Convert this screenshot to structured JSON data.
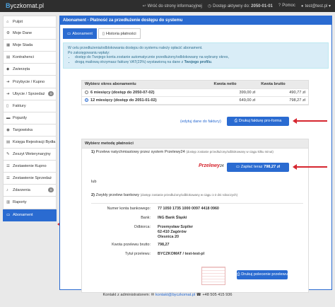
{
  "app": {
    "brand_prefix": "B",
    "brand_rest": "yczkomat.pl"
  },
  "nav": {
    "back_label": "Wróć do strony informacyjnej",
    "access_label": "Dostęp aktywny do:",
    "access_date": "2050-01-01",
    "help_label": "Pomoc",
    "user_label": "test@test.pl"
  },
  "sidebar": {
    "items": [
      {
        "label": "Pulpit",
        "icon": "home-icon"
      },
      {
        "label": "Moje Dane",
        "icon": "gear-icon"
      },
      {
        "label": "Moje Stada",
        "icon": "grid-icon"
      },
      {
        "label": "Kontrahenci",
        "icon": "book-icon"
      },
      {
        "label": "Zwierzęta",
        "icon": "tag-icon"
      },
      {
        "label": "Przybycie / Kupno",
        "icon": "arrow-icon"
      },
      {
        "label": "Ubycie / Sprzedaż",
        "icon": "arrow-icon",
        "badge": "0"
      },
      {
        "label": "Faktury",
        "icon": "doc-icon"
      },
      {
        "label": "Pojazdy",
        "icon": "truck-icon"
      },
      {
        "label": "Targowiska",
        "icon": "pin-icon"
      },
      {
        "label": "Księga Rejestracji Bydła",
        "icon": "book-icon"
      },
      {
        "label": "Zeszyt Weterynaryjny",
        "icon": "pencil-icon"
      },
      {
        "label": "Zestawienie Kupno",
        "icon": "list-icon"
      },
      {
        "label": "Zestawienie Sprzedaż",
        "icon": "list-icon"
      },
      {
        "label": "Zdarzenia",
        "icon": "bell-icon",
        "badge": "0"
      },
      {
        "label": "Raporty",
        "icon": "chart-icon"
      },
      {
        "label": "Abonament",
        "icon": "card-icon",
        "active": true
      }
    ]
  },
  "panel": {
    "title": "Abonament - Płatność za przedłużenie dostępu do systemu",
    "tabs": [
      {
        "label": "Abonament",
        "active": true
      },
      {
        "label": "Historia płatności",
        "active": false
      }
    ],
    "info": {
      "line1": "W celu przedłużenia/odblokowania dostępu do systemu należy opłacić abonament.",
      "line2": "Po zaksięgowaniu wpłaty:",
      "bullet1": "dostęp do Twojego konta zostanie automatycznie przedłużony/odblokowany na wybrany okres,",
      "bullet2_pre": "drogą mailową otrzymasz fakturę VAT(23%) wystawioną na dane z ",
      "bullet2_bold": "Twojego profilu",
      "bullet2_post": "."
    }
  },
  "period_table": {
    "headers": [
      "Wybierz okres abonamentu",
      "Kwota netto",
      "Kwota brutto"
    ],
    "rows": [
      {
        "label": "6 miesięcy (dostęp do 2050-07-02)",
        "netto": "399,00 zł",
        "brutto": "490,77 zł",
        "selected": false
      },
      {
        "label": "12 miesięcy (dostęp do 2051-01-02)",
        "netto": "649,00 zł",
        "brutto": "798,27 zł",
        "selected": true
      }
    ]
  },
  "invoice": {
    "edit_link": "(edytuj dane do faktury)",
    "print_button": "Drukuj fakturę pro-forma"
  },
  "payment": {
    "header": "Wybierz metodę płatności",
    "option1_prefix": "1)",
    "option1_title": "Przelew natychmiastowy przez system Przelewy24",
    "option1_note": "(dostęp zostanie przedłużony/odblokowany w ciągu kilku minut)",
    "p24_logo": "Przelewy",
    "p24_suffix": "24",
    "pay_button": "Zapłać teraz",
    "pay_amount": "798,27 zł",
    "or_label": "lub",
    "option2_prefix": "2)",
    "option2_title": "Zwykły przelew bankowy",
    "option2_note": "(dostęp zostanie przedłużony/odblokowany w ciągu 1-2 dni roboczych)",
    "transfer": {
      "account_label": "Numer konta bankowego:",
      "account_value": "77 1050 1735 1000 0097 4418 0960",
      "bank_label": "Bank:",
      "bank_value": "ING Bank Śląski",
      "recipient_label": "Odbiorca:",
      "recipient_line1": "Przemysław Szpiler",
      "recipient_line2": "62-410 Zagórów",
      "recipient_line3": "Olesnica 20",
      "amount_label": "Kwota przelewu brutto:",
      "amount_value": "798,27",
      "title_label": "Tytuł przelewu:",
      "title_value": "BYCZKOMAT / test-test-pl"
    },
    "print_transfer_button": "Drukuj polecenie przelewu"
  },
  "footer": {
    "contact_label": "Kontakt z administratorem:",
    "email": "kontakt@byczkomat.pl",
    "phone": "+48 505 415 936"
  },
  "colors": {
    "accent": "#2a6bd1",
    "annotation": "#d6262f",
    "info_bg": "#d9edf7"
  }
}
